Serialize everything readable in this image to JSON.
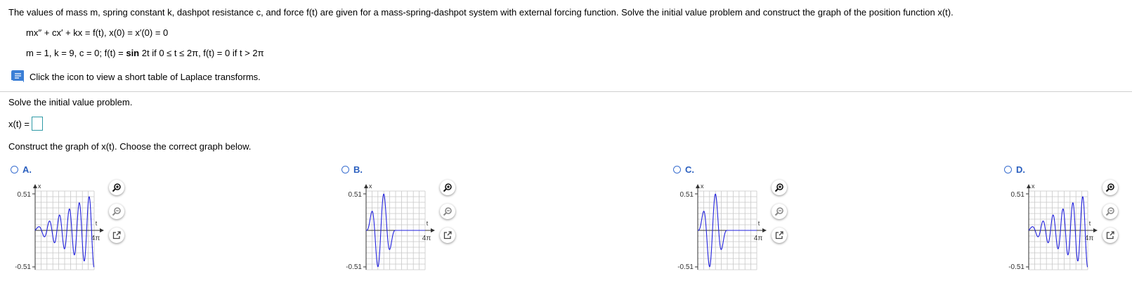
{
  "problem": {
    "statement": "The values of mass m, spring constant k, dashpot resistance c, and force f(t) are given for a mass-spring-dashpot system with external forcing function. Solve the initial value problem and construct the graph of the position function x(t).",
    "equation": "mx′′ + cx′ + kx = f(t), x(0) = x′(0) = 0",
    "params_prefix": "m = 1, k = 9, c = 0; f(t) = ",
    "params_bold": "sin",
    "params_suffix": " 2t if 0 ≤ t ≤ 2π, f(t) = 0 if t > 2π"
  },
  "laplace": {
    "icon": "book-icon",
    "text": "Click the icon to view a short table of Laplace transforms."
  },
  "solve": {
    "prompt": "Solve the initial value problem.",
    "label": "x(t) ="
  },
  "construct": {
    "prompt": "Construct the graph of x(t). Choose the correct graph below."
  },
  "colors": {
    "curve": "#2222dd",
    "grid": "#c8c8c8",
    "accent": "#2a5fbf",
    "answer_border": "#2f9aa6"
  },
  "options": [
    {
      "letter": "A.",
      "y_top": "0.51",
      "y_bottom": "-0.51",
      "x_axis_label": "t",
      "y_axis_label": "x",
      "x_tick_label": "4π",
      "pattern": "growing"
    },
    {
      "letter": "B.",
      "y_top": "0.51",
      "y_bottom": "-0.51",
      "x_axis_label": "t",
      "y_axis_label": "x",
      "x_tick_label": "4π",
      "pattern": "pulse-flat"
    },
    {
      "letter": "C.",
      "y_top": "0.51",
      "y_bottom": "-0.51",
      "x_axis_label": "t",
      "y_axis_label": "x",
      "x_tick_label": "4π",
      "pattern": "pulse-flat"
    },
    {
      "letter": "D.",
      "y_top": "0.51",
      "y_bottom": "-0.51",
      "x_axis_label": "t",
      "y_axis_label": "x",
      "x_tick_label": "4π",
      "pattern": "growing"
    }
  ],
  "tools": {
    "zoom_in": "zoom-in-icon",
    "zoom_out": "zoom-out-icon",
    "popout": "external-link-icon"
  }
}
